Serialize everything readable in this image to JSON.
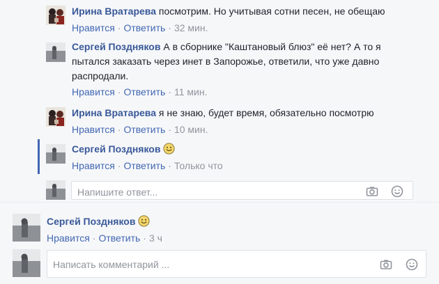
{
  "colors": {
    "name": "#385898",
    "link": "#4267b2",
    "meta": "#90949c",
    "thread_accent": "#4267b2",
    "background": "#f6f7f9"
  },
  "icons": {
    "camera": "camera-icon",
    "smiley": "smiley-icon",
    "emoji": "smile-emoji"
  },
  "replies": [
    {
      "author": "Ирина Вратарева",
      "text": "посмотрим. Но учитывая сотни песен, не обещаю",
      "like": "Нравится",
      "reply": "Ответить",
      "time": "32 мин."
    },
    {
      "author": "Сергей Поздняков",
      "text_line1": "А в сборнике \"Каштановый блюз\" её нет? А то я",
      "text_line2": "пытался заказать через инет в Запорожье, ответили, что уже давно",
      "text_line3": "распродали.",
      "like": "Нравится",
      "reply": "Ответить",
      "time": "11 мин."
    },
    {
      "author": "Ирина Вратарева",
      "text": "я не знаю, будет время, обязательно посмотрю",
      "like": "Нравится",
      "reply": "Ответить",
      "time": "10 мин."
    },
    {
      "author": "Сергей Поздняков",
      "text": "",
      "like": "Нравится",
      "reply": "Ответить",
      "time": "Только что"
    }
  ],
  "reply_input": {
    "placeholder": "Напишите ответ..."
  },
  "comment": {
    "author": "Сергей Поздняков",
    "like": "Нравится",
    "reply": "Ответить",
    "time": "3 ч"
  },
  "comment_input": {
    "placeholder": "Написать комментарий ..."
  }
}
